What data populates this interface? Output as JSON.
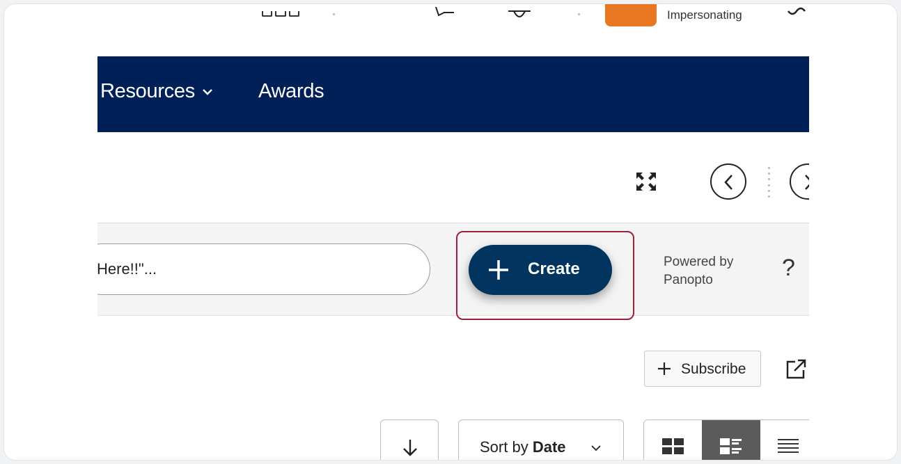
{
  "topbar": {
    "impersonating_label": "Impersonating",
    "icons": [
      "apps-grid-icon",
      "message-icon",
      "bell-icon",
      "settings-icon"
    ]
  },
  "navbar": {
    "cut_prefix": "",
    "items": [
      {
        "label": "Resources",
        "has_dropdown": true
      },
      {
        "label": "Awards",
        "has_dropdown": false
      }
    ],
    "background": "#002057"
  },
  "toolbar": {
    "icons": [
      "fullscreen-icon",
      "previous-icon",
      "next-icon"
    ]
  },
  "panopto": {
    "search_value": "Here!!\"...",
    "create_label": "Create",
    "powered_by": "Powered by",
    "powered_brand": "Panopto",
    "help_label": "?",
    "accent": "#01355f",
    "highlight_color": "#a0203c"
  },
  "folder_actions": {
    "subscribe_label": "Subscribe"
  },
  "sort": {
    "prefix": "Sort by",
    "value": "Date",
    "view_modes": [
      "thumbnail-view",
      "detail-view",
      "list-view"
    ],
    "selected_view": "detail-view"
  }
}
